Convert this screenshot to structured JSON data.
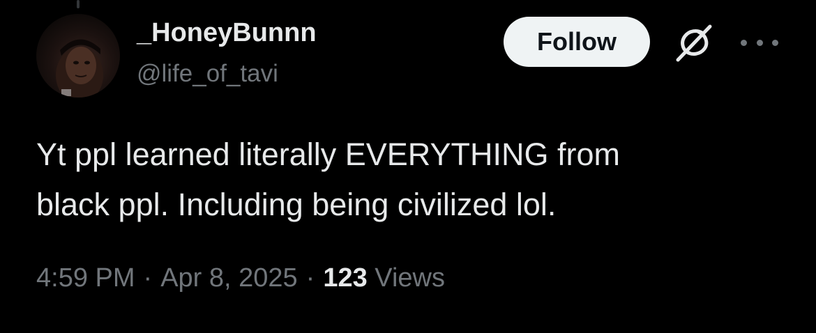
{
  "tweet": {
    "author": {
      "display_name": "_HoneyBunnn",
      "handle": "@life_of_tavi",
      "avatar_icon": "profile-photo"
    },
    "actions": {
      "follow_label": "Follow",
      "grok_icon": "grok-icon",
      "more_icon": "more-icon"
    },
    "text_lines": [
      "Yt ppl learned literally EVERYTHING from",
      "black ppl. Including being civilized lol."
    ],
    "timestamp_time": "4:59 PM",
    "separator": "·",
    "timestamp_date": "Apr 8, 2025",
    "views_count": "123",
    "views_label": "Views"
  },
  "colors": {
    "background": "#000000",
    "primary_text": "#e7e9ea",
    "secondary_text": "#71767b",
    "follow_bg": "#eff3f4",
    "follow_text": "#0f1419"
  }
}
